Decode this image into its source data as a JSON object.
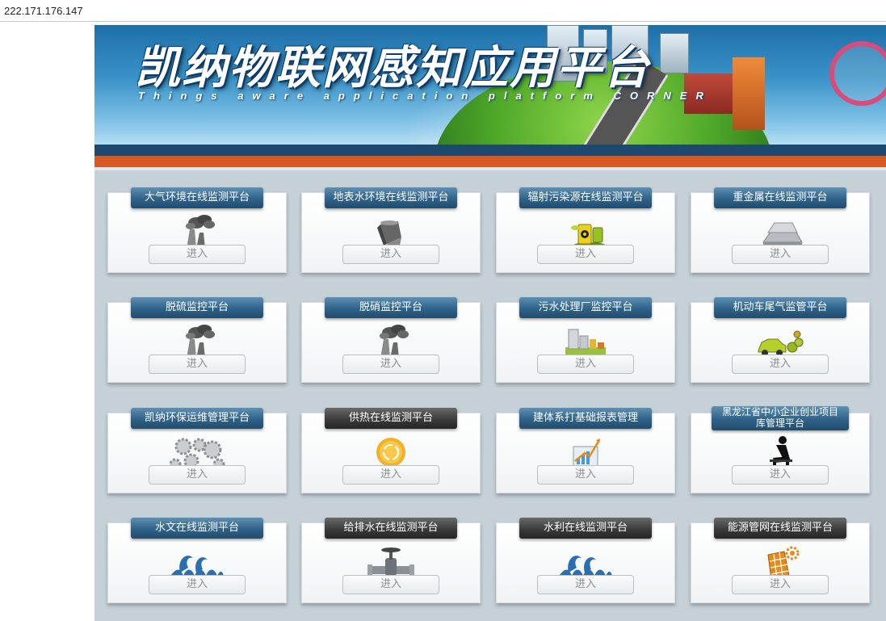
{
  "browser": {
    "url": "222.171.176.147"
  },
  "banner": {
    "title": "凯纳物联网感知应用平台",
    "subtitle": "Things aware application platform CORNER"
  },
  "platforms": [
    {
      "title": "大气环境在线监测平台",
      "icon": "factory-smoke-icon",
      "tab_style": "blue",
      "button": "进入"
    },
    {
      "title": "地表水环境在线监测平台",
      "icon": "water-pouring-icon",
      "tab_style": "blue",
      "button": "进入"
    },
    {
      "title": "辐射污染源在线监测平台",
      "icon": "radioactive-barrel-icon",
      "tab_style": "blue",
      "button": "进入"
    },
    {
      "title": "重金属在线监测平台",
      "icon": "metal-ingot-icon",
      "tab_style": "blue",
      "button": "进入"
    },
    {
      "title": "脱硫监控平台",
      "icon": "factory-smoke-icon",
      "tab_style": "blue",
      "button": "进入"
    },
    {
      "title": "脱硝监控平台",
      "icon": "factory-smoke-icon",
      "tab_style": "blue",
      "button": "进入"
    },
    {
      "title": "污水处理厂监控平台",
      "icon": "treatment-plant-icon",
      "tab_style": "blue",
      "button": "进入"
    },
    {
      "title": "机动车尾气监管平台",
      "icon": "car-exhaust-icon",
      "tab_style": "blue",
      "button": "进入"
    },
    {
      "title": "凯纳环保运维管理平台",
      "icon": "gears-icon",
      "tab_style": "blue",
      "button": "进入"
    },
    {
      "title": "供热在线监测平台",
      "icon": "sun-icon",
      "tab_style": "dark",
      "button": "进入"
    },
    {
      "title": "建体系打基础报表管理",
      "icon": "chart-laptop-icon",
      "tab_style": "blue",
      "button": "进入"
    },
    {
      "title": "黑龙江省中小企业创业项目库管理平台",
      "icon": "thinker-icon",
      "tab_style": "blue",
      "button": "进入"
    },
    {
      "title": "水文在线监测平台",
      "icon": "wave-icon",
      "tab_style": "blue",
      "button": "进入"
    },
    {
      "title": "给排水在线监测平台",
      "icon": "valve-icon",
      "tab_style": "dark",
      "button": "进入"
    },
    {
      "title": "水利在线监测平台",
      "icon": "wave-icon",
      "tab_style": "dark",
      "button": "进入"
    },
    {
      "title": "能源管网在线监测平台",
      "icon": "solar-panel-gear-icon",
      "tab_style": "dark",
      "button": "进入"
    }
  ]
}
